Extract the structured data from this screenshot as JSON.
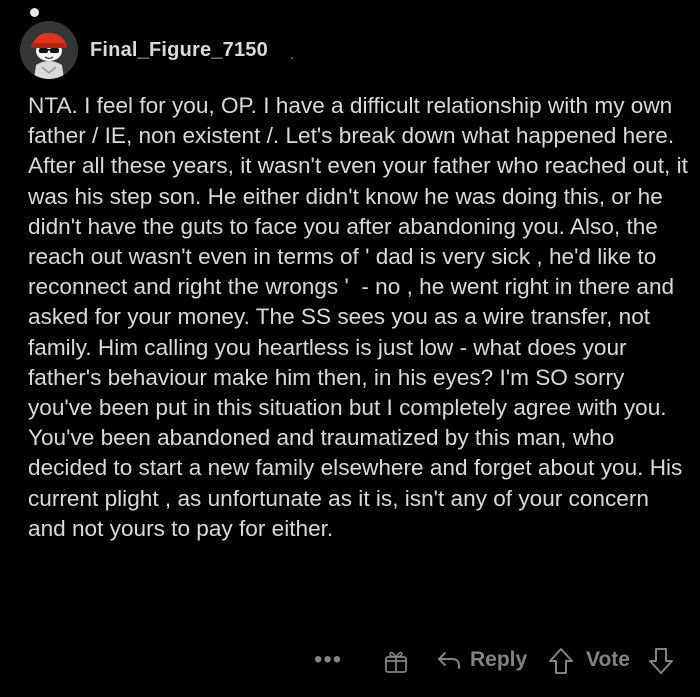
{
  "comment": {
    "author": "Final_Figure_7150",
    "meta_separator": ".",
    "body": "NTA. I feel for you, OP. I have a difficult relationship with my own father / IE, non existent /. Let's break down what happened here. After all these years, it wasn't even your father who reached out, it was his step son. He either didn't know he was doing this, or he didn't have the guts to face you after abandoning you. Also, the reach out wasn't even in terms of ' dad is very sick , he'd like to reconnect and right the wrongs '  - no , he went right in there and asked for your money. The SS sees you as a wire transfer, not family. Him calling you heartless is just low - what does your father's behaviour make him then, in his eyes? I'm SO sorry you've been put in this situation but I completely agree with you. You've been abandoned and traumatized by this man, who decided to start a new family elsewhere and forget about you. His current plight , as unfortunate as it is, isn't any of your concern and not yours to pay for either."
  },
  "actions": {
    "more_label": "•••",
    "reply_label": "Reply",
    "vote_label": "Vote"
  },
  "icons": {
    "avatar": "snoo-avatar-icon",
    "more": "more-options-icon",
    "award": "award-icon",
    "reply": "reply-arrow-icon",
    "upvote": "upvote-arrow-icon",
    "downvote": "downvote-arrow-icon"
  },
  "colors": {
    "background": "#000000",
    "text": "#d7dadc",
    "muted": "#818384"
  }
}
